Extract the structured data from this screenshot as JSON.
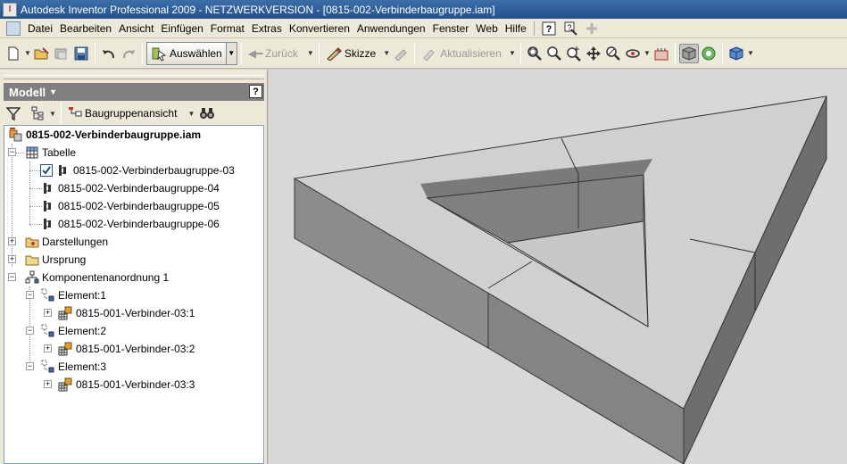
{
  "window": {
    "title": "Autodesk Inventor Professional 2009 - NETZWERKVERSION - [0815-002-Verbinderbaugruppe.iam]"
  },
  "menu": [
    {
      "name": "datei",
      "label": "Datei"
    },
    {
      "name": "bearbeiten",
      "label": "Bearbeiten"
    },
    {
      "name": "ansicht",
      "label": "Ansicht"
    },
    {
      "name": "einfuegen",
      "label": "Einfügen"
    },
    {
      "name": "format",
      "label": "Format"
    },
    {
      "name": "extras",
      "label": "Extras"
    },
    {
      "name": "konvertieren",
      "label": "Konvertieren"
    },
    {
      "name": "anwendungen",
      "label": "Anwendungen"
    },
    {
      "name": "fenster",
      "label": "Fenster"
    },
    {
      "name": "web",
      "label": "Web"
    },
    {
      "name": "hilfe",
      "label": "Hilfe"
    }
  ],
  "toolbar": {
    "select_label": "Auswählen",
    "back_label": "Zurück",
    "sketch_label": "Skizze",
    "update_label": "Aktualisieren"
  },
  "panel": {
    "title": "Modell",
    "help": "?",
    "view_label": "Baugruppenansicht"
  },
  "tree": {
    "root": "0815-002-Verbinderbaugruppe.iam",
    "tabelle": "Tabelle",
    "members": [
      "0815-002-Verbinderbaugruppe-03",
      "0815-002-Verbinderbaugruppe-04",
      "0815-002-Verbinderbaugruppe-05",
      "0815-002-Verbinderbaugruppe-06"
    ],
    "darstellungen": "Darstellungen",
    "ursprung": "Ursprung",
    "pattern": "Komponentenanordnung 1",
    "elements": [
      {
        "label": "Element:1",
        "part": "0815-001-Verbinder-03:1"
      },
      {
        "label": "Element:2",
        "part": "0815-001-Verbinder-03:2"
      },
      {
        "label": "Element:3",
        "part": "0815-001-Verbinder-03:3"
      }
    ]
  },
  "colors": {
    "title_bar": "#2b5a96",
    "chrome": "#ece9d8",
    "viewport_bg": "#d8d8d8",
    "solid_top": "#d0d0d0",
    "solid_side": "#8a8a8a"
  }
}
